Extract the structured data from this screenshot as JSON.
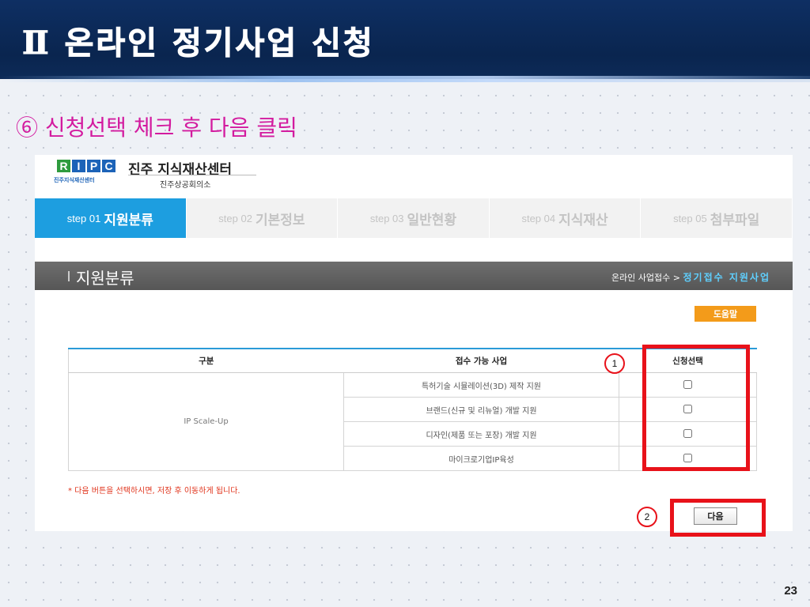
{
  "slide": {
    "title": "Ⅱ 온라인 정기사업 신청",
    "caption": "⑥ 신청선택 체크 후 다음 클릭",
    "page_number": "23"
  },
  "site": {
    "logo_letters": [
      "R",
      "I",
      "P",
      "C"
    ],
    "logo_sub": "진주지식재산센터",
    "org_name": "진주 지식재산센터",
    "org_sub": "진주상공회의소"
  },
  "steps": [
    {
      "num": "step 01",
      "name": "지원분류",
      "active": true
    },
    {
      "num": "step 02",
      "name": "기본정보",
      "active": false
    },
    {
      "num": "step 03",
      "name": "일반현황",
      "active": false
    },
    {
      "num": "step 04",
      "name": "지식재산",
      "active": false
    },
    {
      "num": "step 05",
      "name": "첨부파일",
      "active": false
    }
  ],
  "section": {
    "title": "지원분류",
    "breadcrumb_prefix": "온라인 사업접수 >",
    "breadcrumb_current": "정기접수 지원사업"
  },
  "help_label": "도움말",
  "table": {
    "headers": [
      "구분",
      "접수 가능 사업",
      "신청선택"
    ],
    "category": "IP Scale-Up",
    "rows": [
      {
        "program": "특허기술 시뮬레이션(3D) 제작 지원",
        "checked": false
      },
      {
        "program": "브랜드(신규 및 리뉴얼) 개발 지원",
        "checked": false
      },
      {
        "program": "디자인(제품 또는 포장) 개발 지원",
        "checked": false
      },
      {
        "program": "마이크로기업IP육성",
        "checked": false
      }
    ]
  },
  "notice": "* 다음 버튼을 선택하시면, 저장 후 이동하게 됩니다.",
  "next_label": "다음",
  "markers": [
    "1",
    "2"
  ],
  "colors": {
    "header_navy": "#0a254f",
    "caption_magenta": "#d31b9f",
    "step_active": "#1d9ee0",
    "help_orange": "#f39b1a",
    "highlight_red": "#e8121a"
  }
}
